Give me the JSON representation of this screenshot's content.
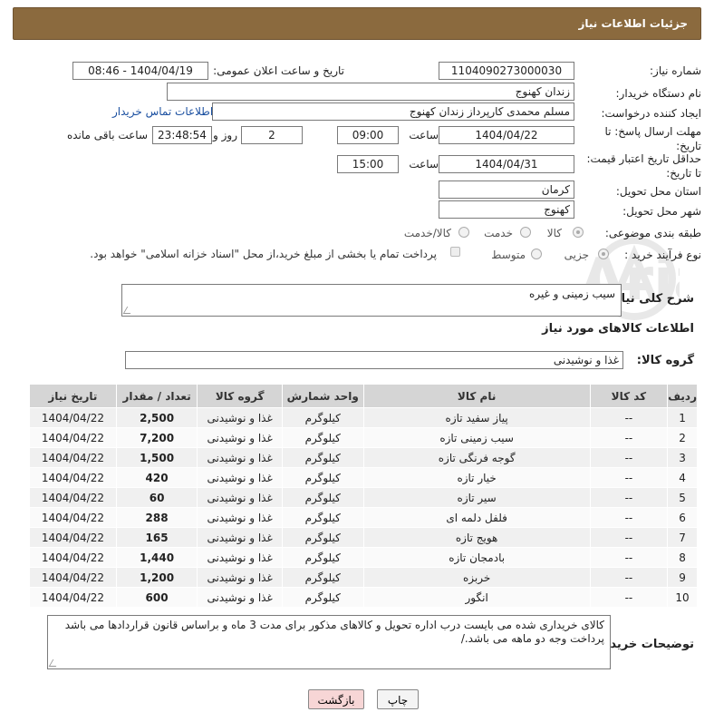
{
  "header": {
    "title": "جزئیات اطلاعات نیاز"
  },
  "fields": {
    "need_number_label": "شماره نیاز:",
    "need_number": "1104090273000030",
    "announce_label": "تاریخ و ساعت اعلان عمومی:",
    "announce_value": "1404/04/19 - 08:46",
    "buyer_label": "نام دستگاه خریدار:",
    "buyer_value": "زندان کهنوج",
    "creator_label": "ایجاد کننده درخواست:",
    "creator_value": "مسلم محمدی کارپرداز زندان کهنوج",
    "contact_link": "اطلاعات تماس خریدار",
    "deadline_label": "مهلت ارسال پاسخ: تا تاریخ:",
    "deadline_date": "1404/04/22",
    "time_label": "ساعت",
    "deadline_time": "09:00",
    "days_value": "2",
    "days_label": "روز و",
    "remaining_time": "23:48:54",
    "remaining_label": "ساعت باقی مانده",
    "validity_label": "حداقل تاریخ اعتبار قیمت: تا تاریخ:",
    "validity_date": "1404/04/31",
    "validity_time": "15:00",
    "province_label": "استان محل تحویل:",
    "province_value": "کرمان",
    "city_label": "شهر محل تحویل:",
    "city_value": "کهنوج",
    "category_label": "طبقه بندی موضوعی:",
    "category_options": [
      "کالا",
      "خدمت",
      "کالا/خدمت"
    ],
    "process_label": "نوع فرآیند خرید :",
    "process_options": [
      "جزیی",
      "متوسط"
    ],
    "payment_note": "پرداخت تمام یا بخشی از مبلغ خرید،از محل \"اسناد خزانه اسلامی\" خواهد بود."
  },
  "description": {
    "label": "شرح کلی نیاز:",
    "value": "سیب زمینی و غیره"
  },
  "items_section": {
    "title": "اطلاعات کالاهای مورد نیاز",
    "group_label": "گروه کالا:",
    "group_value": "غذا و نوشیدنی"
  },
  "table": {
    "headers": [
      "ردیف",
      "کد کالا",
      "نام کالا",
      "واحد شمارش",
      "گروه کالا",
      "تعداد / مقدار",
      "تاریخ نیاز"
    ],
    "rows": [
      [
        "1",
        "--",
        "پیاز سفید تازه",
        "کیلوگرم",
        "غذا و نوشیدنی",
        "2,500",
        "1404/04/22"
      ],
      [
        "2",
        "--",
        "سیب زمینی تازه",
        "کیلوگرم",
        "غذا و نوشیدنی",
        "7,200",
        "1404/04/22"
      ],
      [
        "3",
        "--",
        "گوجه فرنگی تازه",
        "کیلوگرم",
        "غذا و نوشیدنی",
        "1,500",
        "1404/04/22"
      ],
      [
        "4",
        "--",
        "خیار تازه",
        "کیلوگرم",
        "غذا و نوشیدنی",
        "420",
        "1404/04/22"
      ],
      [
        "5",
        "--",
        "سیر تازه",
        "کیلوگرم",
        "غذا و نوشیدنی",
        "60",
        "1404/04/22"
      ],
      [
        "6",
        "--",
        "فلفل دلمه ای",
        "کیلوگرم",
        "غذا و نوشیدنی",
        "288",
        "1404/04/22"
      ],
      [
        "7",
        "--",
        "هویج تازه",
        "کیلوگرم",
        "غذا و نوشیدنی",
        "165",
        "1404/04/22"
      ],
      [
        "8",
        "--",
        "بادمجان تازه",
        "کیلوگرم",
        "غذا و نوشیدنی",
        "1,440",
        "1404/04/22"
      ],
      [
        "9",
        "--",
        "خربزه",
        "کیلوگرم",
        "غذا و نوشیدنی",
        "1,200",
        "1404/04/22"
      ],
      [
        "10",
        "--",
        "انگور",
        "کیلوگرم",
        "غذا و نوشیدنی",
        "600",
        "1404/04/22"
      ]
    ]
  },
  "buyer_notes": {
    "label": "توضیحات خریدار:",
    "line1": "کالای خریداری شده می بایست درب اداره تحویل و کالاهای مذکور برای مدت 3 ماه و براساس قانون قراردادها می باشد",
    "line2": "پرداخت وجه دو ماهه می باشد./"
  },
  "buttons": {
    "print": "چاپ",
    "back": "بازگشت"
  },
  "colors": {
    "header_bg": "#8b6a3e",
    "link": "#1a4fa0",
    "back_button_bg": "#f7d6d6"
  }
}
